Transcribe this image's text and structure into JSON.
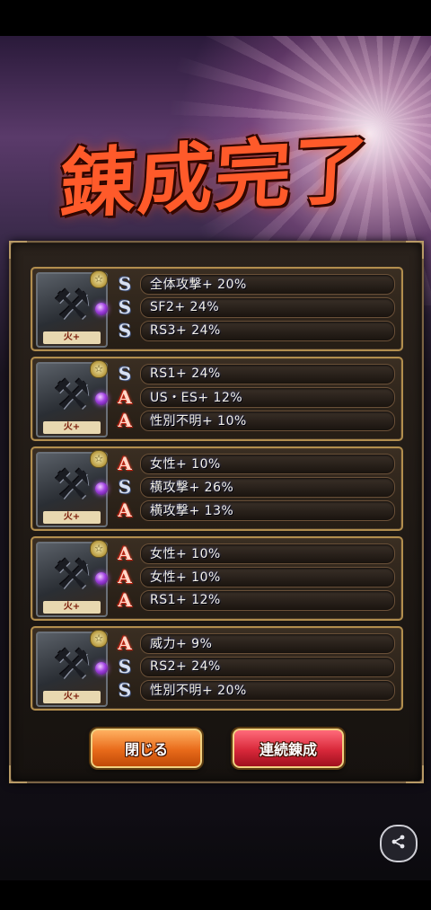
{
  "title": "錬成完了",
  "cards": [
    {
      "element": "火+",
      "rows": [
        {
          "type": "S",
          "text": "全体攻撃+ 20%"
        },
        {
          "type": "S",
          "text": "SF2+ 24%"
        },
        {
          "type": "S",
          "text": "RS3+ 24%"
        }
      ]
    },
    {
      "element": "火+",
      "rows": [
        {
          "type": "S",
          "text": "RS1+ 24%"
        },
        {
          "type": "A",
          "text": "US・ES+ 12%"
        },
        {
          "type": "A",
          "text": "性別不明+ 10%"
        }
      ]
    },
    {
      "element": "火+",
      "rows": [
        {
          "type": "A",
          "text": "女性+ 10%"
        },
        {
          "type": "S",
          "text": "横攻撃+ 26%"
        },
        {
          "type": "A",
          "text": "横攻撃+ 13%"
        }
      ]
    },
    {
      "element": "火+",
      "rows": [
        {
          "type": "A",
          "text": "女性+ 10%"
        },
        {
          "type": "A",
          "text": "女性+ 10%"
        },
        {
          "type": "A",
          "text": "RS1+ 12%"
        }
      ]
    },
    {
      "element": "火+",
      "rows": [
        {
          "type": "A",
          "text": "威力+ 9%"
        },
        {
          "type": "S",
          "text": "RS2+ 24%"
        },
        {
          "type": "S",
          "text": "性別不明+ 20%"
        }
      ]
    }
  ],
  "buttons": {
    "close_label": "閉じる",
    "again_label": "連続錬成"
  },
  "icons": {
    "weapon": "axe-weapon-icon",
    "share": "share-icon"
  },
  "colors": {
    "title": "#ff5a2a",
    "close_button": "#e86a1a",
    "again_button": "#d8283a",
    "frame_gold": "#b28e4e"
  }
}
